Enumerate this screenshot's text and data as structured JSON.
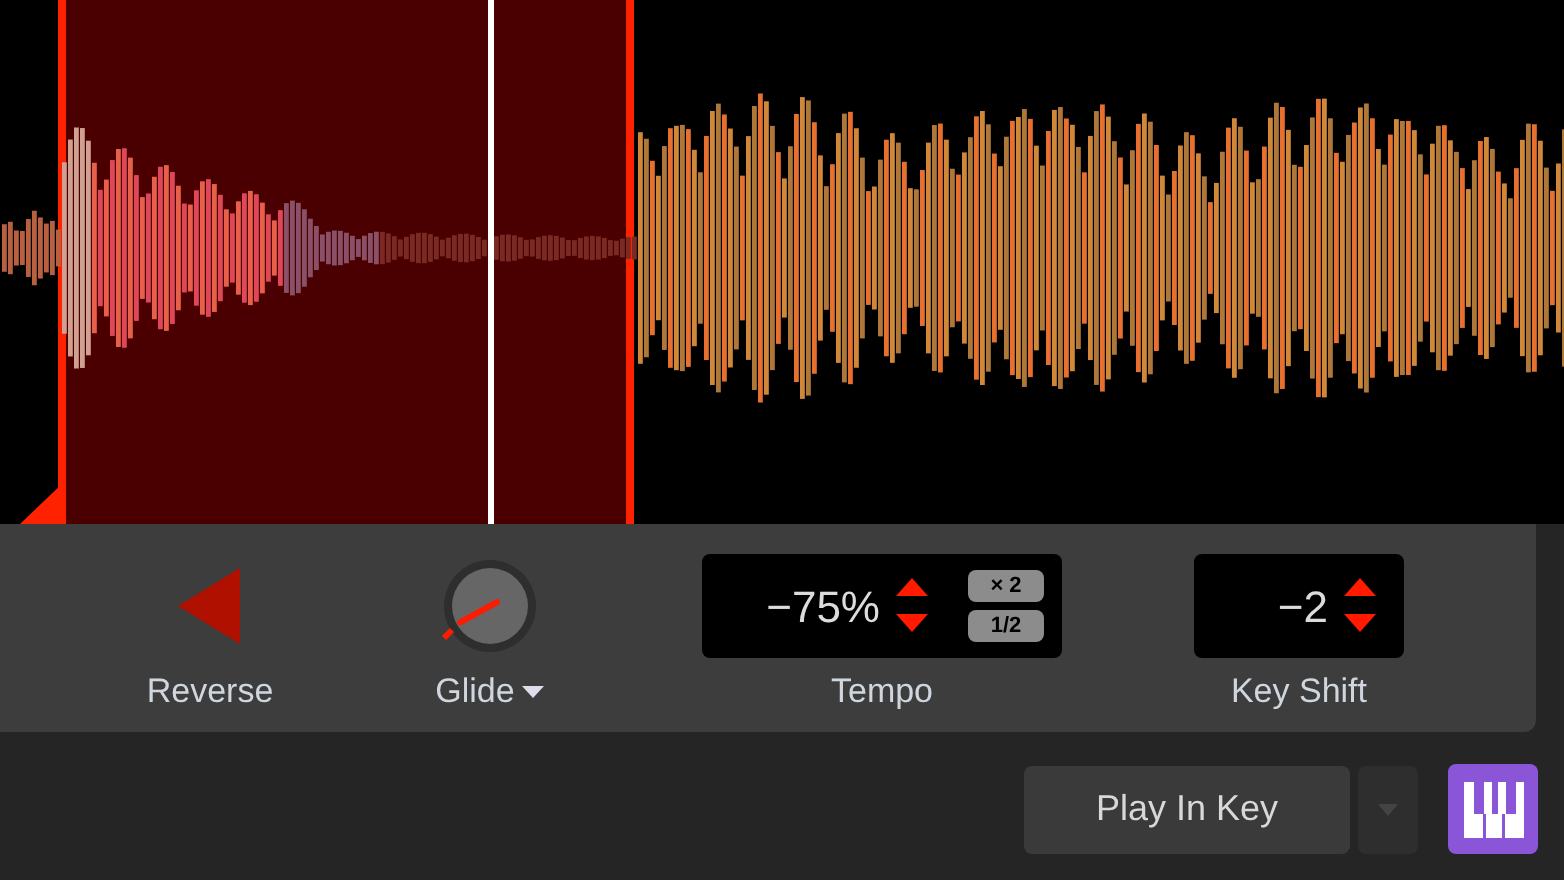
{
  "controls": [
    {
      "kind": "reverse",
      "label": "Reverse"
    },
    {
      "kind": "knob",
      "label": "Glide"
    },
    {
      "kind": "tempo",
      "label": "Tempo",
      "value": "−75%",
      "buttons": [
        "× 2",
        "1/2"
      ]
    },
    {
      "kind": "keyshift",
      "label": "Key Shift",
      "value": "−2"
    }
  ],
  "play_button": {
    "label": "Play In Key"
  }
}
